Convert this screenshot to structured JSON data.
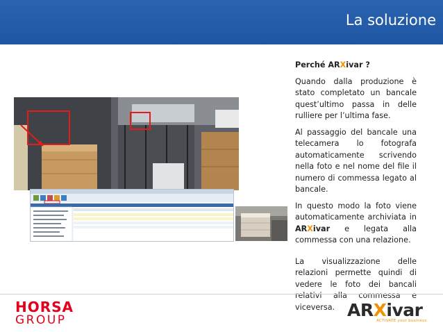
{
  "header": {
    "title": "La soluzione",
    "background": "#1f56a3"
  },
  "content": {
    "heading_prefix": "Perché AR",
    "heading_x": "X",
    "heading_suffix": "ivar ?",
    "p1": "Quando dalla produzione è stato completato un bancale quest’ultimo passa in delle rulliere per l’ultima fase.",
    "p2": "Al passaggio del bancale una telecamera lo fotografa automaticamente scrivendo nella foto e nel nome del file il numero di commessa legato al bancale.",
    "p3_start": "In questo modo la foto viene automaticamente archiviata in ",
    "p3_brand_ar": "AR",
    "p3_brand_x": "X",
    "p3_brand_ivar": "ivar",
    "p3_end": " e legata alla commessa con una relazione.",
    "p4": "La visualizzazione delle relazioni permette quindi di vedere le foto dei bancali relativi alla commessa e viceversa."
  },
  "footer": {
    "horsa_top": "HORSA",
    "horsa_bottom": "GROUP",
    "arxivar_ar": "AR",
    "arxivar_x": "X",
    "arxivar_ivar": "ivar",
    "arxivar_tagline": "ACTIVATE your business",
    "accent_color": "#f39200",
    "horsa_color": "#e2001a"
  }
}
